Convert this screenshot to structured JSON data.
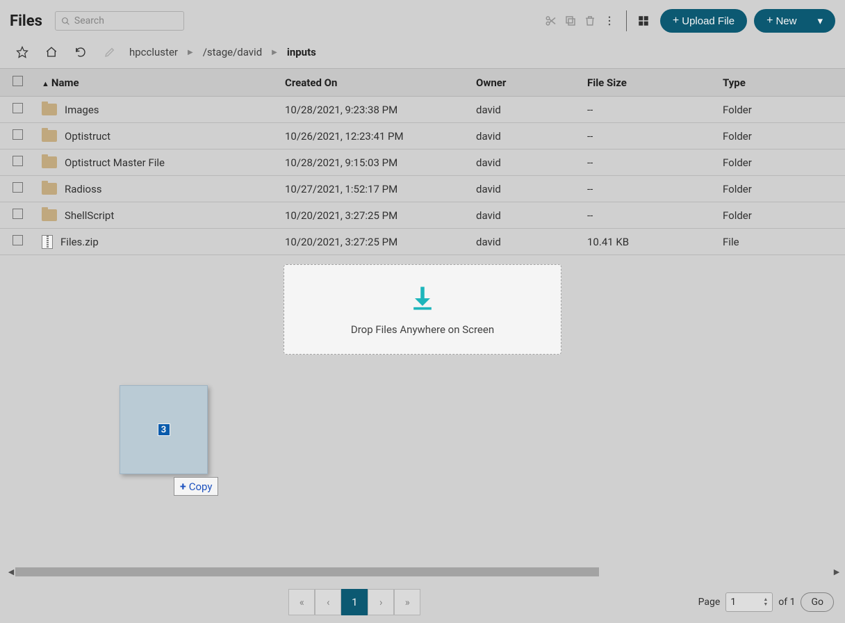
{
  "header": {
    "title": "Files",
    "search_placeholder": "Search",
    "upload_label": "Upload File",
    "new_label": "New"
  },
  "breadcrumbs": {
    "items": [
      "hpccluster",
      "/stage/david",
      "inputs"
    ]
  },
  "columns": {
    "name": "Name",
    "created": "Created On",
    "owner": "Owner",
    "size": "File Size",
    "type": "Type"
  },
  "rows": [
    {
      "name": "Images",
      "created": "10/28/2021, 9:23:38 PM",
      "owner": "david",
      "size": "--",
      "type": "Folder",
      "kind": "folder"
    },
    {
      "name": "Optistruct",
      "created": "10/26/2021, 12:23:41 PM",
      "owner": "david",
      "size": "--",
      "type": "Folder",
      "kind": "folder"
    },
    {
      "name": "Optistruct Master File",
      "created": "10/28/2021, 9:15:03 PM",
      "owner": "david",
      "size": "--",
      "type": "Folder",
      "kind": "folder"
    },
    {
      "name": "Radioss",
      "created": "10/27/2021, 1:52:17 PM",
      "owner": "david",
      "size": "--",
      "type": "Folder",
      "kind": "folder"
    },
    {
      "name": "ShellScript",
      "created": "10/20/2021, 3:27:25 PM",
      "owner": "david",
      "size": "--",
      "type": "Folder",
      "kind": "folder"
    },
    {
      "name": "Files.zip",
      "created": "10/20/2021, 3:27:25 PM",
      "owner": "david",
      "size": "10.41 KB",
      "type": "File",
      "kind": "zip"
    }
  ],
  "dropzone": {
    "text": "Drop Files Anywhere on Screen"
  },
  "drag": {
    "count": "3",
    "copy_label": "Copy"
  },
  "pagination": {
    "first": "«",
    "prev": "‹",
    "current": "1",
    "next": "›",
    "last": "»",
    "page_label": "Page",
    "page_value": "1",
    "of_text": "of 1",
    "go": "Go"
  }
}
